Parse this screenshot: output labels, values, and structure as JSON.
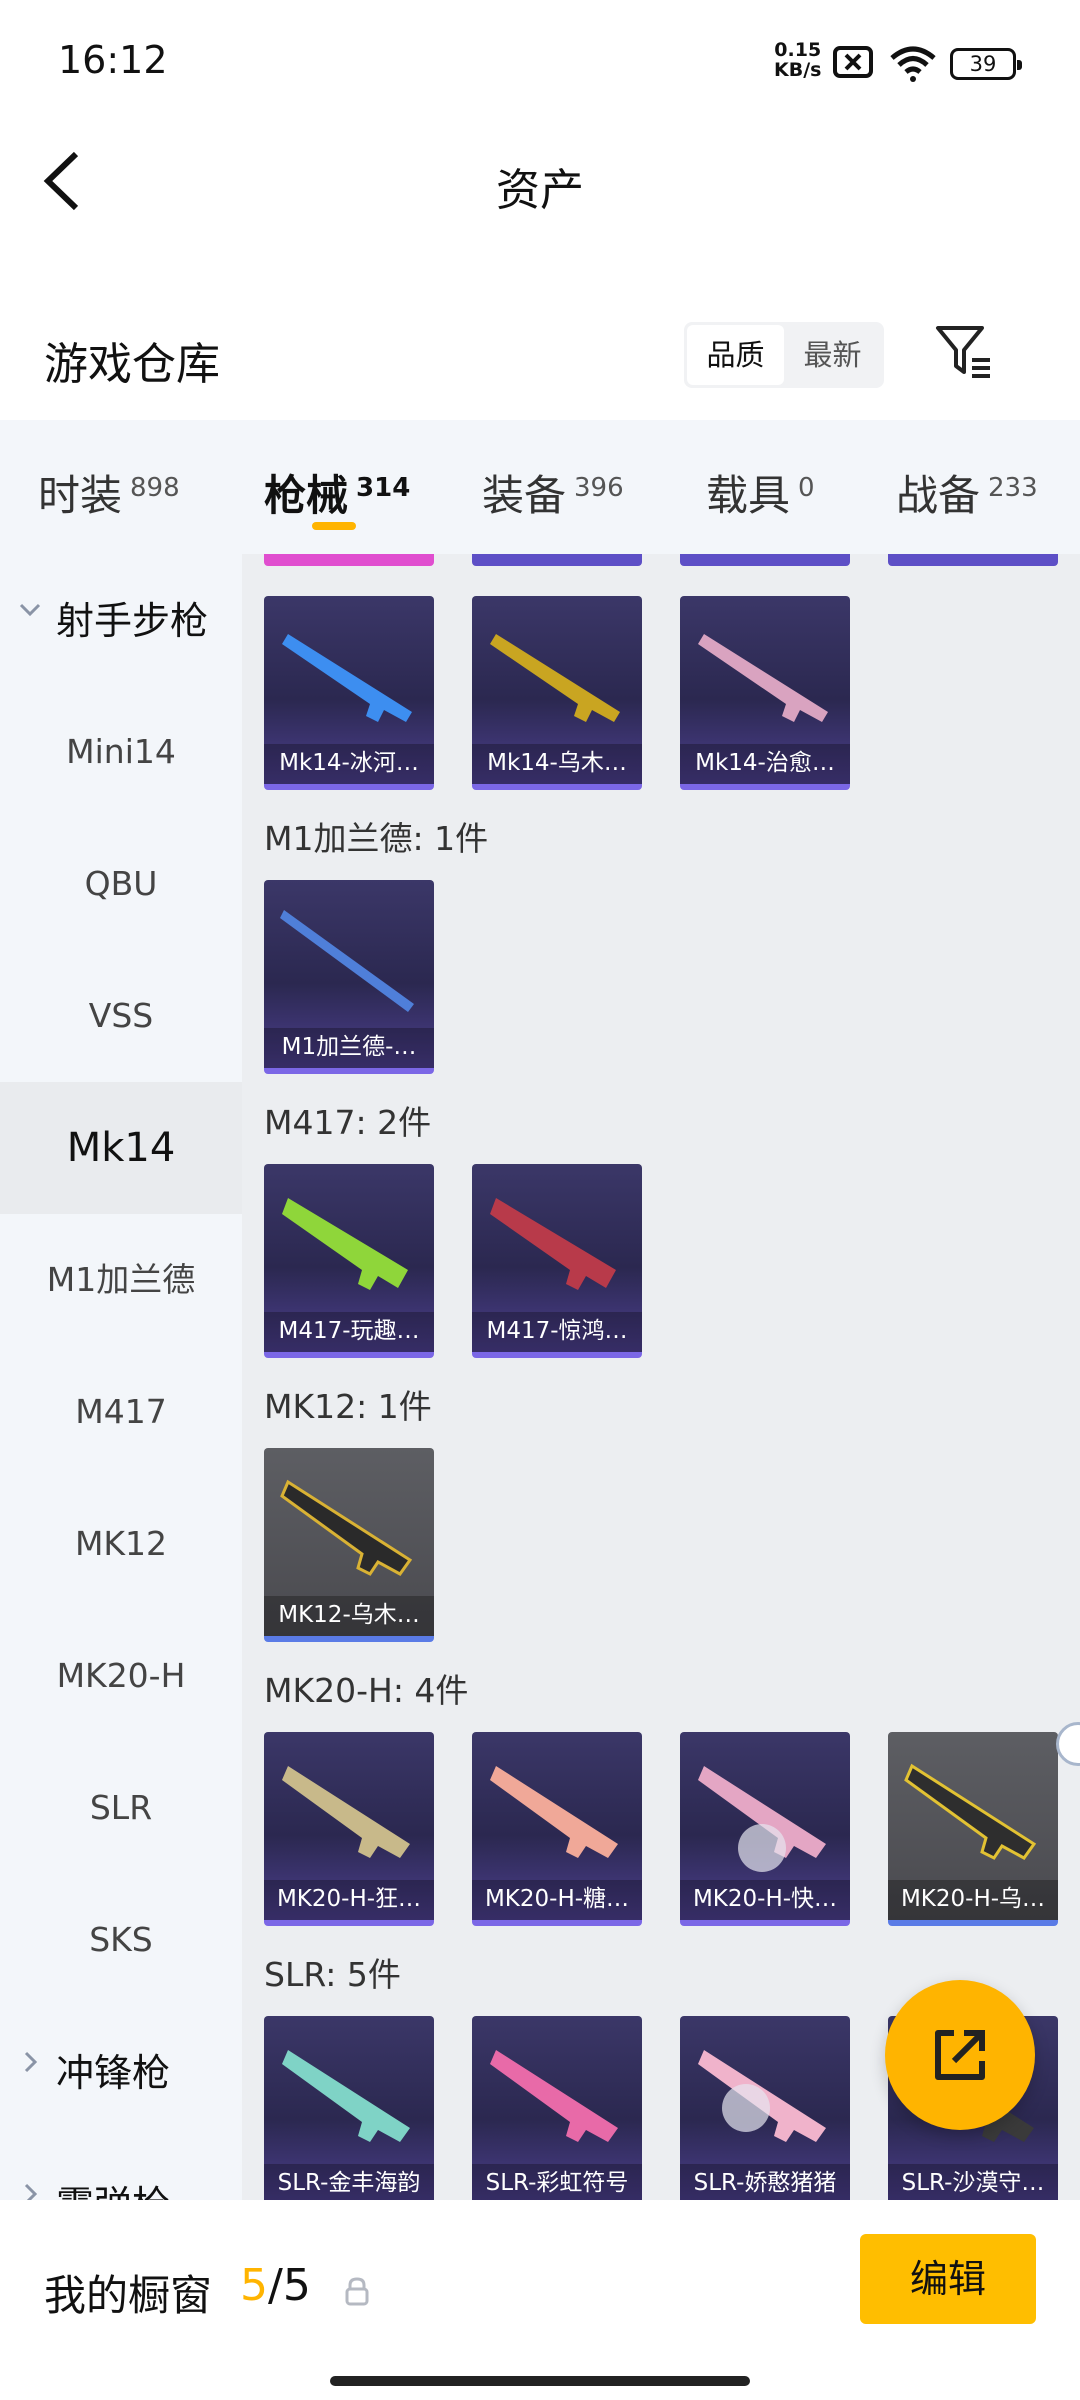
{
  "status": {
    "time": "16:12",
    "net_speed_value": "0.15",
    "net_speed_unit": "KB/s",
    "battery": "39"
  },
  "header": {
    "title": "资产"
  },
  "warehouse": {
    "title": "游戏仓库",
    "sort_options": [
      {
        "label": "品质",
        "active": true
      },
      {
        "label": "最新",
        "active": false
      }
    ]
  },
  "tabs": [
    {
      "label": "时装",
      "count": "898"
    },
    {
      "label": "枪械",
      "count": "314",
      "active": true
    },
    {
      "label": "装备",
      "count": "396"
    },
    {
      "label": "载具",
      "count": "0"
    },
    {
      "label": "战备",
      "count": "233"
    }
  ],
  "sidebar": {
    "category_rifle": "射手步枪",
    "subs": [
      "Mini14",
      "QBU",
      "VSS",
      "Mk14",
      "M1加兰德",
      "M417",
      "MK12",
      "MK20-H",
      "SLR",
      "SKS"
    ],
    "active_sub": "Mk14",
    "category_smg": "冲锋枪",
    "category_shotgun": "霰弹枪"
  },
  "sections": [
    {
      "title": "",
      "items": [
        "Mk14-冰河…",
        "Mk14-乌木…",
        "Mk14-治愈…"
      ]
    },
    {
      "title": "M1加兰德: 1件",
      "items": [
        "M1加兰德-…"
      ]
    },
    {
      "title": "M417: 2件",
      "items": [
        "M417-玩趣…",
        "M417-惊鸿…"
      ]
    },
    {
      "title": "MK12: 1件",
      "items": [
        "MK12-乌木…"
      ]
    },
    {
      "title": "MK20-H: 4件",
      "items": [
        "MK20-H-狂…",
        "MK20-H-糖…",
        "MK20-H-快…",
        "MK20-H-乌…"
      ]
    },
    {
      "title": "SLR: 5件",
      "items": [
        "SLR-金丰海韵",
        "SLR-彩虹符号",
        "SLR-娇憨猪猪",
        "SLR-沙漠守…"
      ]
    }
  ],
  "bottom": {
    "label": "我的橱窗",
    "count_used": "5",
    "count_sep": "/",
    "count_total": "5",
    "edit_label": "编辑"
  },
  "icons": {
    "back": "chevron-left-icon",
    "filter": "filter-icon",
    "fab": "share-external-icon",
    "lock": "lock-icon"
  },
  "colors": {
    "accent": "#ffb400",
    "card_purple": "#3b3768",
    "card_border": "#7b67e6"
  }
}
